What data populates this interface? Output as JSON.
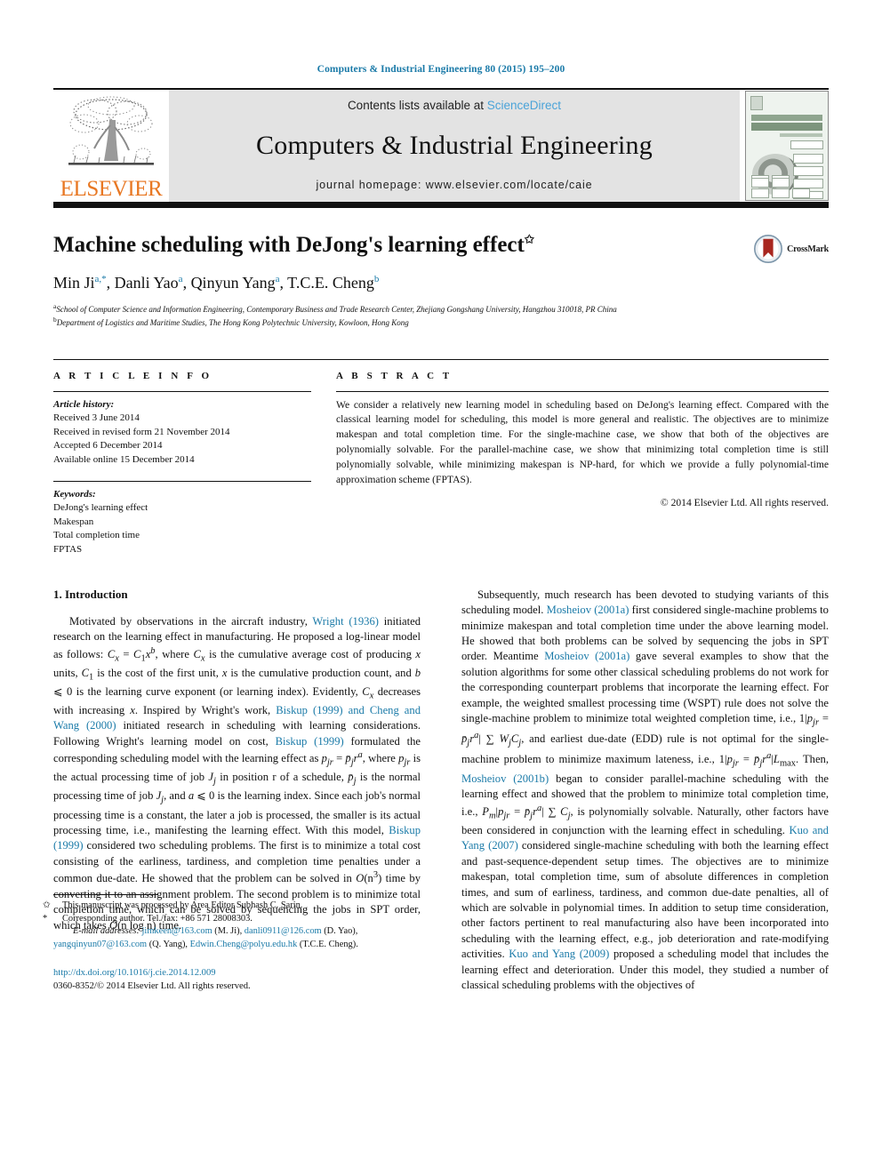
{
  "running_head": "Computers & Industrial Engineering 80 (2015) 195–200",
  "masthead": {
    "publisher_wordmark": "ELSEVIER",
    "contents_prefix": "Contents lists available at ",
    "contents_link": "ScienceDirect",
    "journal_title": "Computers & Industrial Engineering",
    "homepage": "journal homepage: www.elsevier.com/locate/caie",
    "brand_orange": "#e87722",
    "link_blue": "#4aa3d8",
    "band_gray": "#e3e3e3"
  },
  "title_block": {
    "title": "Machine scheduling with DeJong's learning effect",
    "title_footnote_mark": "✩",
    "authors_plain": "Min Ji a,*, Danli Yao a, Qinyun Yang a, T.C.E. Cheng b",
    "authors": [
      {
        "name": "Min Ji",
        "marks": "a,*"
      },
      {
        "name": "Danli Yao",
        "marks": "a"
      },
      {
        "name": "Qinyun Yang",
        "marks": "a"
      },
      {
        "name": "T.C.E. Cheng",
        "marks": "b"
      }
    ],
    "affiliations": [
      {
        "mark": "a",
        "text": "School of Computer Science and Information Engineering, Contemporary Business and Trade Research Center, Zhejiang Gongshang University, Hangzhou 310018, PR China"
      },
      {
        "mark": "b",
        "text": "Department of Logistics and Maritime Studies, The Hong Kong Polytechnic University, Kowloon, Hong Kong"
      }
    ],
    "crossmark_label": "CrossMark"
  },
  "article_info": {
    "heading": "A R T I C L E   I N F O",
    "history_label": "Article history:",
    "history": [
      "Received 3 June 2014",
      "Received in revised form 21 November 2014",
      "Accepted 6 December 2014",
      "Available online 15 December 2014"
    ],
    "keywords_label": "Keywords:",
    "keywords": [
      "DeJong's learning effect",
      "Makespan",
      "Total completion time",
      "FPTAS"
    ]
  },
  "abstract": {
    "heading": "A B S T R A C T",
    "text": "We consider a relatively new learning model in scheduling based on DeJong's learning effect. Compared with the classical learning model for scheduling, this model is more general and realistic. The objectives are to minimize makespan and total completion time. For the single-machine case, we show that both of the objectives are polynomially solvable. For the parallel-machine case, we show that minimizing total completion time is still polynomially solvable, while minimizing makespan is NP-hard, for which we provide a fully polynomial-time approximation scheme (FPTAS).",
    "copyright": "© 2014 Elsevier Ltd. All rights reserved."
  },
  "body": {
    "section_number_title": "1. Introduction",
    "left_paragraph_1_parts": [
      {
        "t": "Motivated by observations in the aircraft industry, ",
        "k": "plain"
      },
      {
        "t": "Wright (1936)",
        "k": "ref"
      },
      {
        "t": " initiated research on the learning effect in manufacturing. He proposed a log-linear model as follows: ",
        "k": "plain"
      },
      {
        "t": "C",
        "k": "mi"
      },
      {
        "t": "x",
        "k": "sub-i"
      },
      {
        "t": " = ",
        "k": "plain"
      },
      {
        "t": "C",
        "k": "mi"
      },
      {
        "t": "1",
        "k": "sub"
      },
      {
        "t": "x",
        "k": "mi"
      },
      {
        "t": "b",
        "k": "sup-i"
      },
      {
        "t": ", where ",
        "k": "plain"
      },
      {
        "t": "C",
        "k": "mi"
      },
      {
        "t": "x",
        "k": "sub-i"
      },
      {
        "t": " is the cumulative average cost of producing ",
        "k": "plain"
      },
      {
        "t": "x",
        "k": "mi"
      },
      {
        "t": " units, ",
        "k": "plain"
      },
      {
        "t": "C",
        "k": "mi"
      },
      {
        "t": "1",
        "k": "sub"
      },
      {
        "t": " is the cost of the first unit, ",
        "k": "plain"
      },
      {
        "t": "x",
        "k": "mi"
      },
      {
        "t": " is the cumulative production count, and ",
        "k": "plain"
      },
      {
        "t": "b",
        "k": "mi"
      },
      {
        "t": " ⩽ 0 is the learning curve exponent (or learning index). Evidently, ",
        "k": "plain"
      },
      {
        "t": "C",
        "k": "mi"
      },
      {
        "t": "x",
        "k": "sub-i"
      },
      {
        "t": " decreases with increasing ",
        "k": "plain"
      },
      {
        "t": "x",
        "k": "mi"
      },
      {
        "t": ". Inspired by Wright's work, ",
        "k": "plain"
      },
      {
        "t": "Biskup (1999) and Cheng and Wang (2000)",
        "k": "ref"
      },
      {
        "t": " initiated research in scheduling with learning considerations. Following Wright's learning model on cost, ",
        "k": "plain"
      },
      {
        "t": "Biskup (1999)",
        "k": "ref"
      },
      {
        "t": " formulated the corresponding scheduling model with the learning effect as ",
        "k": "plain"
      },
      {
        "t": "p",
        "k": "mi"
      },
      {
        "t": "jr",
        "k": "sub-i"
      },
      {
        "t": " = ",
        "k": "plain"
      },
      {
        "t": "p̄",
        "k": "mi"
      },
      {
        "t": "j",
        "k": "sub-i"
      },
      {
        "t": "r",
        "k": "mi"
      },
      {
        "t": "a",
        "k": "sup-i"
      },
      {
        "t": ", where ",
        "k": "plain"
      },
      {
        "t": "p",
        "k": "mi"
      },
      {
        "t": "jr",
        "k": "sub-i"
      },
      {
        "t": " is the actual processing time of job ",
        "k": "plain"
      },
      {
        "t": "J",
        "k": "mi"
      },
      {
        "t": "j",
        "k": "sub-i"
      },
      {
        "t": " in position r of a schedule, ",
        "k": "plain"
      },
      {
        "t": "p̄",
        "k": "mi"
      },
      {
        "t": "j",
        "k": "sub-i"
      },
      {
        "t": " is the normal processing time of job ",
        "k": "plain"
      },
      {
        "t": "J",
        "k": "mi"
      },
      {
        "t": "j",
        "k": "sub-i"
      },
      {
        "t": ", and ",
        "k": "plain"
      },
      {
        "t": "a",
        "k": "mi"
      },
      {
        "t": " ⩽ 0 is the learning index. Since each job's normal processing time is a constant, the later a job is processed, the smaller is its actual processing time, i.e., manifesting the learning effect. With this model, ",
        "k": "plain"
      },
      {
        "t": "Biskup (1999)",
        "k": "ref"
      },
      {
        "t": " considered two scheduling problems. The first is to minimize a total cost consisting of the earliness, tardiness, and completion time penalties under a common due-date. He showed that the problem can be solved in ",
        "k": "plain"
      },
      {
        "t": "O",
        "k": "mi"
      },
      {
        "t": "(n",
        "k": "plain"
      },
      {
        "t": "3",
        "k": "sup"
      },
      {
        "t": ") time by converting it to an assignment problem. The second problem is to minimize total completion time, which can be solved by sequencing the jobs in SPT order, which takes ",
        "k": "plain"
      },
      {
        "t": "O",
        "k": "mi"
      },
      {
        "t": "(n log n) time.",
        "k": "plain"
      }
    ],
    "right_paragraph_1_parts": [
      {
        "t": "Subsequently, much research has been devoted to studying variants of this scheduling model. ",
        "k": "plain"
      },
      {
        "t": "Mosheiov (2001a)",
        "k": "ref"
      },
      {
        "t": " first considered single-machine problems to minimize makespan and total completion time under the above learning model. He showed that both problems can be solved by sequencing the jobs in SPT order. Meantime ",
        "k": "plain"
      },
      {
        "t": "Mosheiov (2001a)",
        "k": "ref"
      },
      {
        "t": " gave several examples to show that the solution algorithms for some other classical scheduling problems do not work for the corresponding counterpart problems that incorporate the learning effect. For example, the weighted smallest processing time (WSPT) rule does not solve the single-machine problem to minimize total weighted completion time, i.e., 1|",
        "k": "plain"
      },
      {
        "t": "p",
        "k": "mi"
      },
      {
        "t": "jr",
        "k": "sub-i"
      },
      {
        "t": " = ",
        "k": "plain"
      },
      {
        "t": "p̄",
        "k": "mi"
      },
      {
        "t": "j",
        "k": "sub-i"
      },
      {
        "t": "r",
        "k": "mi"
      },
      {
        "t": "a",
        "k": "sup-i"
      },
      {
        "t": "| ∑ ",
        "k": "plain"
      },
      {
        "t": "W",
        "k": "mi"
      },
      {
        "t": "j",
        "k": "sub-i"
      },
      {
        "t": "C",
        "k": "mi"
      },
      {
        "t": "j",
        "k": "sub-i"
      },
      {
        "t": ", and earliest due-date (EDD) rule is not optimal for the single-machine problem to minimize maximum lateness, i.e., 1|",
        "k": "plain"
      },
      {
        "t": "p",
        "k": "mi"
      },
      {
        "t": "jr",
        "k": "sub-i"
      },
      {
        "t": " = ",
        "k": "plain"
      },
      {
        "t": "p̄",
        "k": "mi"
      },
      {
        "t": "j",
        "k": "sub-i"
      },
      {
        "t": "r",
        "k": "mi"
      },
      {
        "t": "a",
        "k": "sup-i"
      },
      {
        "t": "|",
        "k": "plain"
      },
      {
        "t": "L",
        "k": "mi"
      },
      {
        "t": "max",
        "k": "sub"
      },
      {
        "t": ". Then, ",
        "k": "plain"
      },
      {
        "t": "Mosheiov (2001b)",
        "k": "ref"
      },
      {
        "t": " began to consider parallel-machine scheduling with the learning effect and showed that the problem to minimize total completion time, i.e., ",
        "k": "plain"
      },
      {
        "t": "P",
        "k": "mi"
      },
      {
        "t": "m",
        "k": "sub-i"
      },
      {
        "t": "|",
        "k": "plain"
      },
      {
        "t": "p",
        "k": "mi"
      },
      {
        "t": "jr",
        "k": "sub-i"
      },
      {
        "t": " = ",
        "k": "plain"
      },
      {
        "t": "p̄",
        "k": "mi"
      },
      {
        "t": "j",
        "k": "sub-i"
      },
      {
        "t": "r",
        "k": "mi"
      },
      {
        "t": "a",
        "k": "sup-i"
      },
      {
        "t": "| ∑ ",
        "k": "plain"
      },
      {
        "t": "C",
        "k": "mi"
      },
      {
        "t": "j",
        "k": "sub-i"
      },
      {
        "t": ", is polynomially solvable. Naturally, other factors have been considered in conjunction with the learning effect in scheduling. ",
        "k": "plain"
      },
      {
        "t": "Kuo and Yang (2007)",
        "k": "ref"
      },
      {
        "t": " considered single-machine scheduling with both the learning effect and past-sequence-dependent setup times. The objectives are to minimize makespan, total completion time, sum of absolute differences in completion times, and sum of earliness, tardiness, and common due-date penalties, all of which are solvable in polynomial times. In addition to setup time consideration, other factors pertinent to real manufacturing also have been incorporated into scheduling with the learning effect, e.g., job deterioration and rate-modifying activities. ",
        "k": "plain"
      },
      {
        "t": "Kuo and Yang (2009)",
        "k": "ref"
      },
      {
        "t": " proposed a scheduling model that includes the learning effect and deterioration. Under this model, they studied a number of classical scheduling problems with the objectives of",
        "k": "plain"
      }
    ]
  },
  "footnotes": {
    "line1_mark": "✩",
    "line1": "This manuscript was processed by Area Editor Subhash C. Sarin.",
    "line2_mark": "*",
    "line2": "Corresponding author. Tel./fax: +86 571 28008303.",
    "emails_label": "E-mail addresses:",
    "emails": [
      {
        "addr": "jimkeen@163.com",
        "who": "(M. Ji)"
      },
      {
        "addr": "danli0911@126.com",
        "who": "(D. Yao)"
      },
      {
        "addr": "yangqinyun07@163.com",
        "who": "(Q. Yang)"
      },
      {
        "addr": "Edwin.Cheng@polyu.edu.hk",
        "who": "(T.C.E. Cheng)"
      }
    ],
    "doi": "http://dx.doi.org/10.1016/j.cie.2014.12.009",
    "issn_line": "0360-8352/© 2014 Elsevier Ltd. All rights reserved."
  }
}
